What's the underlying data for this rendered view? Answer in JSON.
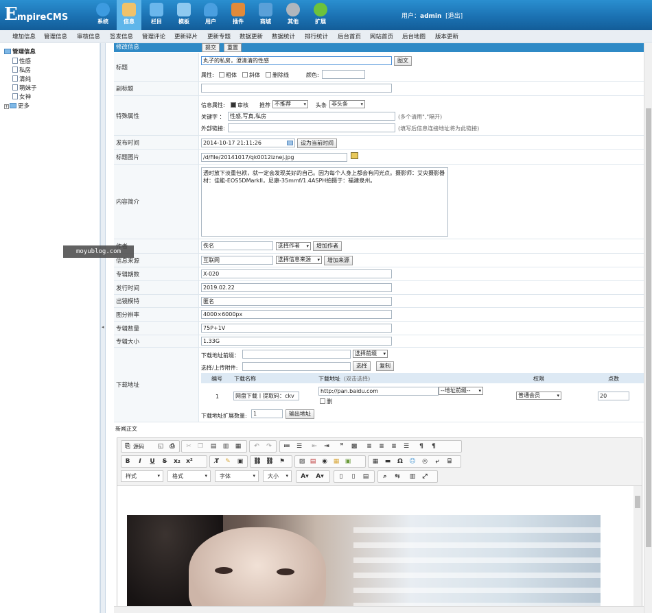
{
  "logo": {
    "big": "E",
    "rest": "mpireCMS"
  },
  "nav": [
    {
      "label": "系统",
      "icon": "globe-icon",
      "color": "#3d9be0"
    },
    {
      "label": "信息",
      "icon": "edit-icon",
      "color": "#f0c26a"
    },
    {
      "label": "栏目",
      "icon": "folder-icon",
      "color": "#6bb7ec"
    },
    {
      "label": "模板",
      "icon": "window-icon",
      "color": "#8ec9f0"
    },
    {
      "label": "用户",
      "icon": "user-icon",
      "color": "#4a9fe0"
    },
    {
      "label": "插件",
      "icon": "tools-icon",
      "color": "#e08a3a"
    },
    {
      "label": "商城",
      "icon": "shop-icon",
      "color": "#5aa0d8"
    },
    {
      "label": "其他",
      "icon": "gear-icon",
      "color": "#b0b6bd"
    },
    {
      "label": "扩展",
      "icon": "plus-icon",
      "color": "#6cc23c"
    }
  ],
  "user": {
    "prefix": "用户：",
    "name": "admin",
    "logout": "[退出]"
  },
  "menu": [
    "增加信息",
    "管理信息",
    "审核信息",
    "签发信息",
    "管理评论",
    "更新碎片",
    "更新专题",
    "数据更新",
    "数据统计",
    "排行统计",
    "后台首页",
    "网站首页",
    "后台地图",
    "版本更新"
  ],
  "tree": {
    "root": "管理信息",
    "items": [
      "性感",
      "私房",
      "清纯",
      "萌妹子",
      "女神"
    ],
    "more": "更多"
  },
  "form": {
    "header": "修改信息",
    "submit": "提交",
    "reset": "重置",
    "title_label": "标题",
    "title_value": "丸子的私房，澄清清的性感",
    "title_pic_btn": "图文",
    "attr_label": "属性:",
    "bold": "粗体",
    "italic": "斜体",
    "strike": "删除线",
    "color_label": "颜色:",
    "subtitle_label": "副标题",
    "special_label": "特殊属性",
    "info_attr": "信息属性:",
    "audit": "审核",
    "recommend": "推荐",
    "recommend_val": "不推荐",
    "headline": "头条",
    "headline_val": "非头条",
    "keywords_label": "关键字 ：",
    "keywords_value": "性感,写真,私房",
    "keywords_hint": "(多个请用\",\"隔开)",
    "outlink_label": "外部链接:",
    "outlink_hint": "(填写后信息连接地址将为此链接)",
    "pubtime_label": "发布时间",
    "pubtime_value": "2014-10-17 21:11:26",
    "pubtime_btn": "设为当前时间",
    "titlepic_label": "标题图片",
    "titlepic_value": "/d/file/20141017/qk0012iznej.jpg",
    "intro_label": "内容简介",
    "intro_value": "透时放下淡重包袱，就一定会发现美好的自己。因为每个人身上都会有闪光点。摄影师：艾央摄影器材：佳能-EOS5DMarkII，尼康-35mmf/1.4ASPH拍摄于：福建泉州。",
    "author_label": "作者",
    "author_value": "佚名",
    "author_sel": "选择作者",
    "author_add": "增加作者",
    "source_label": "信息来源",
    "source_value": "互联网",
    "source_sel": "选择信息来源",
    "source_add": "增加来源",
    "issue_label": "专辑期数",
    "issue_value": "X-020",
    "date_label": "发行时间",
    "date_value": "2019.02.22",
    "model_label": "出镜模特",
    "model_value": "匿名",
    "res_label": "图分辨率",
    "res_value": "4000×6000px",
    "count_label": "专辑数量",
    "count_value": "75P+1V",
    "size_label": "专辑大小",
    "size_value": "1.33G",
    "download_label": "下载地址",
    "dl_prefix_label": "下载地址前缀：",
    "dl_prefix_sel": "选择前缀",
    "dl_upload_label": "选择/上传附件:",
    "dl_choose": "选择",
    "dl_copy": "复制",
    "dl_head": {
      "no": "编号",
      "name": "下载名称",
      "addr": "下载地址",
      "addr_hint": "(双击选择)",
      "perm": "权限",
      "points": "点数"
    },
    "dl_row": {
      "no": "1",
      "name": "网盘下载丨提取码：ckv",
      "addr": "http://pan.baidu.com",
      "addr_sel": "--地址前缀--",
      "delete": "删",
      "perm": "普通会员",
      "points": "20"
    },
    "dl_expand_label": "下载地址扩展数量:",
    "dl_expand_value": "1",
    "dl_output": "输出地址",
    "body_label": "新闻正文"
  },
  "editor": {
    "source": "源码",
    "style": "样式",
    "format": "格式",
    "font": "字体",
    "size": "大小"
  },
  "watermark": "moyublog.com"
}
